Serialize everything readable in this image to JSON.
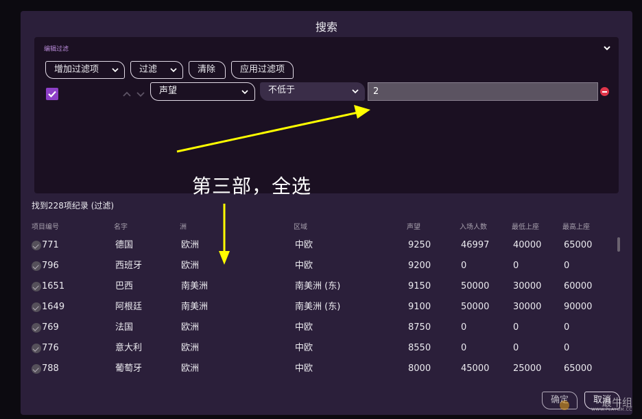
{
  "dialog": {
    "title": "搜索"
  },
  "filter_panel": {
    "label": "编辑过滤",
    "toolbar": {
      "add_filter": "增加过滤项",
      "filter": "过滤",
      "clear": "清除",
      "apply": "应用过滤项"
    },
    "row": {
      "checked": true,
      "field": "声望",
      "operator": "不低于",
      "value": "2"
    }
  },
  "annotation": {
    "text": "第三部，全选",
    "color": "#ffff00"
  },
  "results": {
    "count_text": "找到228项纪录 (过滤)",
    "columns": [
      "项目编号",
      "名字",
      "洲",
      "区域",
      "声望",
      "入场人数",
      "最低上座",
      "最高上座"
    ],
    "rows": [
      [
        "771",
        "德国",
        "欧洲",
        "中欧",
        "9250",
        "46997",
        "40000",
        "65000"
      ],
      [
        "796",
        "西班牙",
        "欧洲",
        "中欧",
        "9200",
        "0",
        "0",
        "0"
      ],
      [
        "1651",
        "巴西",
        "南美洲",
        "南美洲 (东)",
        "9150",
        "50000",
        "30000",
        "60000"
      ],
      [
        "1649",
        "阿根廷",
        "南美洲",
        "南美洲 (东)",
        "9100",
        "50000",
        "30000",
        "90000"
      ],
      [
        "769",
        "法国",
        "欧洲",
        "中欧",
        "8750",
        "0",
        "0",
        "0"
      ],
      [
        "776",
        "意大利",
        "欧洲",
        "中欧",
        "8550",
        "0",
        "0",
        "0"
      ],
      [
        "788",
        "葡萄牙",
        "欧洲",
        "中欧",
        "8000",
        "45000",
        "25000",
        "65000"
      ]
    ]
  },
  "footer": {
    "ok": "确定",
    "cancel": "取消"
  },
  "watermark": {
    "text": "最牛组",
    "sub": "WWW.PLAYGM.CC",
    "logo_text": "PGS"
  },
  "colors": {
    "accent": "#8d3fc7",
    "danger": "#e0354a",
    "panel": "#1b1022",
    "dialog": "#2b1f3a"
  }
}
